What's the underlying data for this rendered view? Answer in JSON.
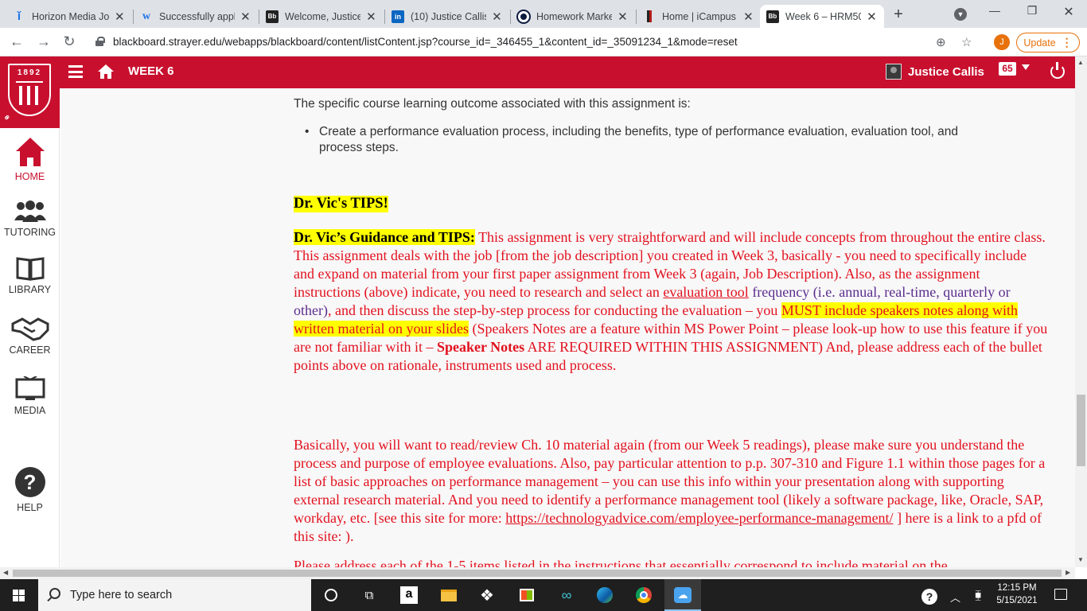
{
  "browser": {
    "tabs": [
      {
        "title": "Horizon Media Jo",
        "icon": "i-icon",
        "color": "#1a73e8"
      },
      {
        "title": "Successfully appl",
        "icon": "w-icon",
        "color": "#1a73e8"
      },
      {
        "title": "Welcome, Justice",
        "icon": "Bb",
        "color": "#000000"
      },
      {
        "title": "(10) Justice Callis",
        "icon": "in",
        "color": "#0a66c2"
      },
      {
        "title": "Homework Marke",
        "icon": "circle-icon",
        "color": "#0b1b3f"
      },
      {
        "title": "Home | iCampus",
        "icon": "flag-icon",
        "color": "#b31b1b"
      },
      {
        "title": "Week 6 – HRM50",
        "icon": "Bb",
        "color": "#000000",
        "active": true
      }
    ],
    "url": "blackboard.strayer.edu/webapps/blackboard/content/listContent.jsp?course_id=_346455_1&content_id=_35091234_1&mode=reset",
    "profile_initial": "J",
    "update_label": "Update"
  },
  "header": {
    "logo_year": "1892",
    "title": "WEEK 6",
    "user_name": "Justice Callis",
    "notification_count": "65",
    "brand_color": "#c8102e"
  },
  "nav": {
    "items": [
      {
        "label": "HOME",
        "icon": "home-icon"
      },
      {
        "label": "TUTORING",
        "icon": "people-icon"
      },
      {
        "label": "LIBRARY",
        "icon": "book-icon"
      },
      {
        "label": "CAREER",
        "icon": "handshake-icon"
      },
      {
        "label": "MEDIA",
        "icon": "monitor-icon"
      },
      {
        "label": "HELP",
        "icon": "question-icon"
      }
    ]
  },
  "content": {
    "intro": "The specific course learning outcome associated with this assignment is:",
    "bullet_line1": "Create a performance evaluation process, including the benefits, type of performance evaluation, evaluation tool, and",
    "bullet_line2": "process steps.",
    "tips_heading": "Dr. Vic's TIPS!",
    "guidance": {
      "label": "Dr. Vic’s Guidance and TIPS:",
      "t1": " This assignment is very straightforward and will include concepts from throughout the entire class. This assignment deals with the job [from the job description] you created in Week 3, basically - you need to specifically include and expand on material from your first paper assignment from Week 3 (again, Job Description). Also, as the assignment instructions (above) indicate, you need to research and select an ",
      "t2": "evaluation tool",
      "t3": "frequency (i.e. annual, real-time, quarterly or other)",
      "t4": ", and then discuss the step-by-step process for conducting the evaluation – you ",
      "t5": "MUST include speakers notes along with written material on your slides",
      "t6": " (Speakers Notes are a feature within MS Power Point – please look-up how to use this feature if you are not familiar with it – ",
      "t7": "Speaker Notes",
      "t8": "  ARE REQUIRED WITHIN THIS ASSIGNMENT)   And, please address each of the bullet points above on rationale, instruments used and process."
    },
    "para2": {
      "t1": "Basically, you will want to read/review Ch. 10 material again (from our Week 5 readings), please make sure you understand the process and purpose of employee evaluations.  Also, pay particular attention to p.p. 307-310 and Figure 1.1 within those pages for a list of basic approaches on performance management – you can use this info within your presentation along with supporting external research material. And you need to identify a performance management tool (likely a software package, like, Oracle, SAP, workday, etc. [see this site for more: ",
      "link": "https://technologyadvice.com/employee-performance-management/",
      "t2": " ] here is a link to a pfd of this site: )."
    },
    "para3_cut": "Please address each of the 1-5 items listed in the instructions that essentially correspond to include material on the"
  },
  "taskbar": {
    "search_placeholder": "Type here to search",
    "time": "12:15 PM",
    "date": "5/15/2021"
  }
}
